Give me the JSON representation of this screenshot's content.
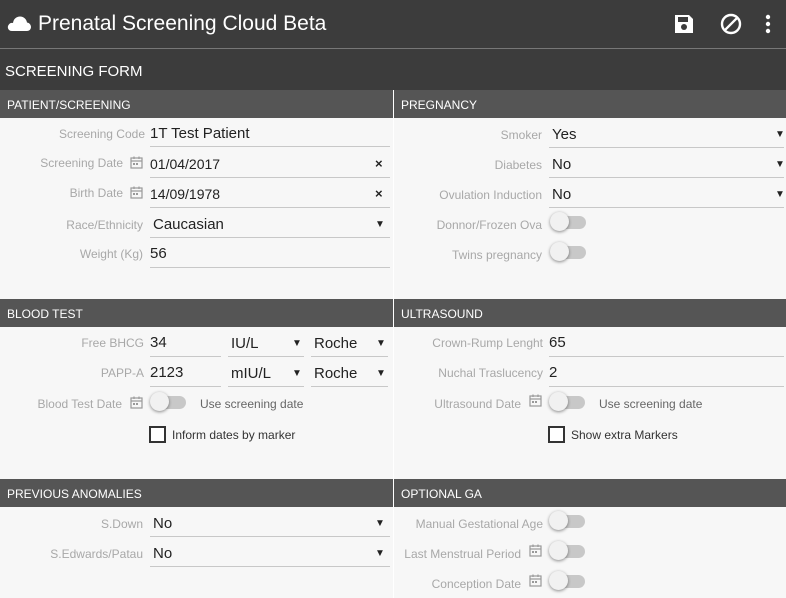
{
  "app": {
    "title": "Prenatal Screening Cloud Beta"
  },
  "toolbar": {
    "save_icon": "save-icon",
    "cancel_icon": "cancel-icon",
    "menu_icon": "more-vert-icon"
  },
  "form": {
    "title": "SCREENING FORM"
  },
  "patient": {
    "header": "PATIENT/SCREENING",
    "screening_code_label": "Screening Code",
    "screening_code_value": "1T Test Patient",
    "screening_date_label": "Screening Date",
    "screening_date_value": "01/04/2017",
    "birth_date_label": "Birth Date",
    "birth_date_value": "14/09/1978",
    "race_label": "Race/Ethnicity",
    "race_value": "Caucasian",
    "weight_label": "Weight (Kg)",
    "weight_value": "56",
    "clear_glyph": "×"
  },
  "pregnancy": {
    "header": "PREGNANCY",
    "smoker_label": "Smoker",
    "smoker_value": "Yes",
    "diabetes_label": "Diabetes",
    "diabetes_value": "No",
    "ovulation_label": "Ovulation Induction",
    "ovulation_value": "No",
    "donor_label": "Donnor/Frozen Ova",
    "donor_on": false,
    "twins_label": "Twins pregnancy",
    "twins_on": false
  },
  "blood": {
    "header": "BLOOD TEST",
    "bhcg_label": "Free BHCG",
    "bhcg_value": "34",
    "bhcg_unit": "IU/L",
    "bhcg_lab": "Roche",
    "pappa_label": "PAPP-A",
    "pappa_value": "2123",
    "pappa_unit": "mIU/L",
    "pappa_lab": "Roche",
    "date_label": "Blood Test Date",
    "use_screening_date": "Use screening date",
    "inform_dates": "Inform dates by marker"
  },
  "ultrasound": {
    "header": "ULTRASOUND",
    "crl_label": "Crown-Rump Lenght",
    "crl_value": "65",
    "nt_label": "Nuchal Traslucency",
    "nt_value": "2",
    "date_label": "Ultrasound Date",
    "use_screening_date": "Use screening date",
    "extra_markers": "Show extra Markers"
  },
  "anomalies": {
    "header": "PREVIOUS ANOMALIES",
    "sdown_label": "S.Down",
    "sdown_value": "No",
    "sedwards_label": "S.Edwards/Patau",
    "sedwards_value": "No"
  },
  "optional_ga": {
    "header": "OPTIONAL GA",
    "manual_label": "Manual Gestational Age",
    "lmp_label": "Last Menstrual Period",
    "conception_label": "Conception Date"
  },
  "glyphs": {
    "dropdown": "▼"
  }
}
